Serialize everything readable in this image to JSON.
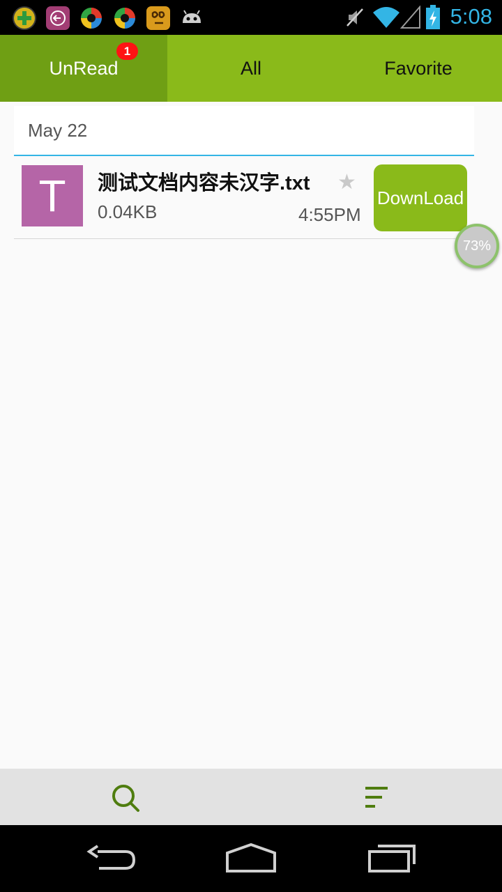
{
  "status_bar": {
    "time": "5:08",
    "notification_icons": [
      "plus-app-icon",
      "back-app-icon",
      "ball-app-icon",
      "ball-app-icon-2",
      "chinese-app-icon",
      "android-icon"
    ],
    "status_icons": [
      "muted-icon",
      "wifi-icon",
      "signal-icon",
      "battery-charging-icon"
    ]
  },
  "tabs": [
    {
      "label": "UnRead",
      "active": true,
      "badge": "1"
    },
    {
      "label": "All",
      "active": false
    },
    {
      "label": "Favorite",
      "active": false
    }
  ],
  "list": {
    "date_header": "May 22",
    "items": [
      {
        "thumb_letter": "T",
        "name": "测试文档内容未汉字.txt",
        "size": "0.04KB",
        "time": "4:55PM",
        "action_label": "DownLoad"
      }
    ]
  },
  "floating_indicator": "73%",
  "toolbar": {
    "icons": [
      "search-icon",
      "sort-icon"
    ]
  },
  "colors": {
    "accent_green": "#8aba1a",
    "active_tab": "#6f9f14",
    "badge_red": "#ff1414",
    "thumb_purple": "#b565a7",
    "divider_blue": "#33b5e5"
  }
}
